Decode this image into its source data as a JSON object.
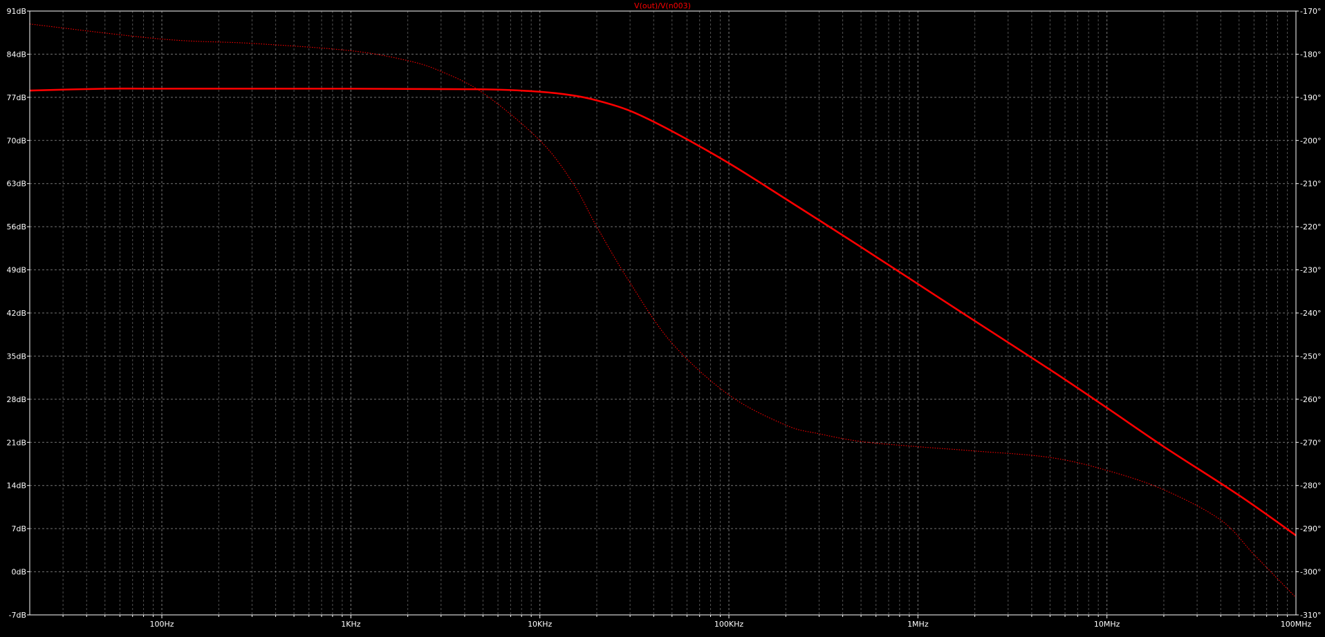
{
  "chart_data": {
    "type": "line",
    "title": "V(out)/V(n003)",
    "xscale": "log",
    "xlim": [
      20,
      100000000
    ],
    "x_tick_labels": [
      "100Hz",
      "1KHz",
      "10KHz",
      "100KHz",
      "1MHz",
      "10MHz",
      "100MHz"
    ],
    "x_tick_values": [
      100,
      1000,
      10000,
      100000,
      1000000,
      10000000,
      100000000
    ],
    "y_left": {
      "unit": "dB",
      "ylim": [
        -7,
        91
      ],
      "tick_labels": [
        "91dB",
        "84dB",
        "77dB",
        "70dB",
        "63dB",
        "56dB",
        "49dB",
        "42dB",
        "35dB",
        "28dB",
        "21dB",
        "14dB",
        "7dB",
        "0dB",
        "-7dB"
      ],
      "tick_values": [
        91,
        84,
        77,
        70,
        63,
        56,
        49,
        42,
        35,
        28,
        21,
        14,
        7,
        0,
        -7
      ]
    },
    "y_right": {
      "unit": "°",
      "ylim": [
        -310,
        -170
      ],
      "tick_labels": [
        "-170°",
        "-180°",
        "-190°",
        "-200°",
        "-210°",
        "-220°",
        "-230°",
        "-240°",
        "-250°",
        "-260°",
        "-270°",
        "-280°",
        "-290°",
        "-300°",
        "-310°"
      ],
      "tick_values": [
        -170,
        -180,
        -190,
        -200,
        -210,
        -220,
        -230,
        -240,
        -250,
        -260,
        -270,
        -280,
        -290,
        -300,
        -310
      ]
    },
    "grid": true,
    "colors": {
      "background": "#000000",
      "trace": "#ff0000",
      "grid": "#8a8a8a",
      "axis": "#ffffff",
      "label": "#ffffff",
      "title": "#ff0000"
    },
    "series": [
      {
        "name": "magnitude",
        "axis": "left",
        "style": "solid",
        "x": [
          20,
          50,
          100,
          1000,
          5000,
          10000,
          15000,
          20000,
          30000,
          50000,
          100000,
          200000,
          500000,
          1000000,
          2000000,
          5000000,
          10000000,
          20000000,
          50000000,
          100000000
        ],
        "y": [
          78.1,
          78.4,
          78.4,
          78.4,
          78.3,
          77.9,
          77.3,
          76.5,
          74.8,
          71.5,
          66.3,
          60.5,
          52.7,
          46.7,
          40.7,
          32.8,
          26.6,
          20.3,
          12.4,
          5.9
        ]
      },
      {
        "name": "phase",
        "axis": "right",
        "style": "dotted",
        "x": [
          20,
          100,
          300,
          1000,
          2000,
          3000,
          5000,
          10000,
          15000,
          20000,
          30000,
          50000,
          100000,
          200000,
          300000,
          500000,
          1000000,
          2000000,
          5000000,
          10000000,
          20000000,
          40000000,
          60000000,
          100000000
        ],
        "y": [
          -173,
          -176.5,
          -177.5,
          -179.2,
          -181.5,
          -184,
          -189,
          -200,
          -210,
          -220,
          -233,
          -247,
          -259,
          -266,
          -268,
          -269.8,
          -271,
          -272,
          -273.5,
          -276.5,
          -281,
          -288,
          -296,
          -306
        ]
      }
    ]
  }
}
